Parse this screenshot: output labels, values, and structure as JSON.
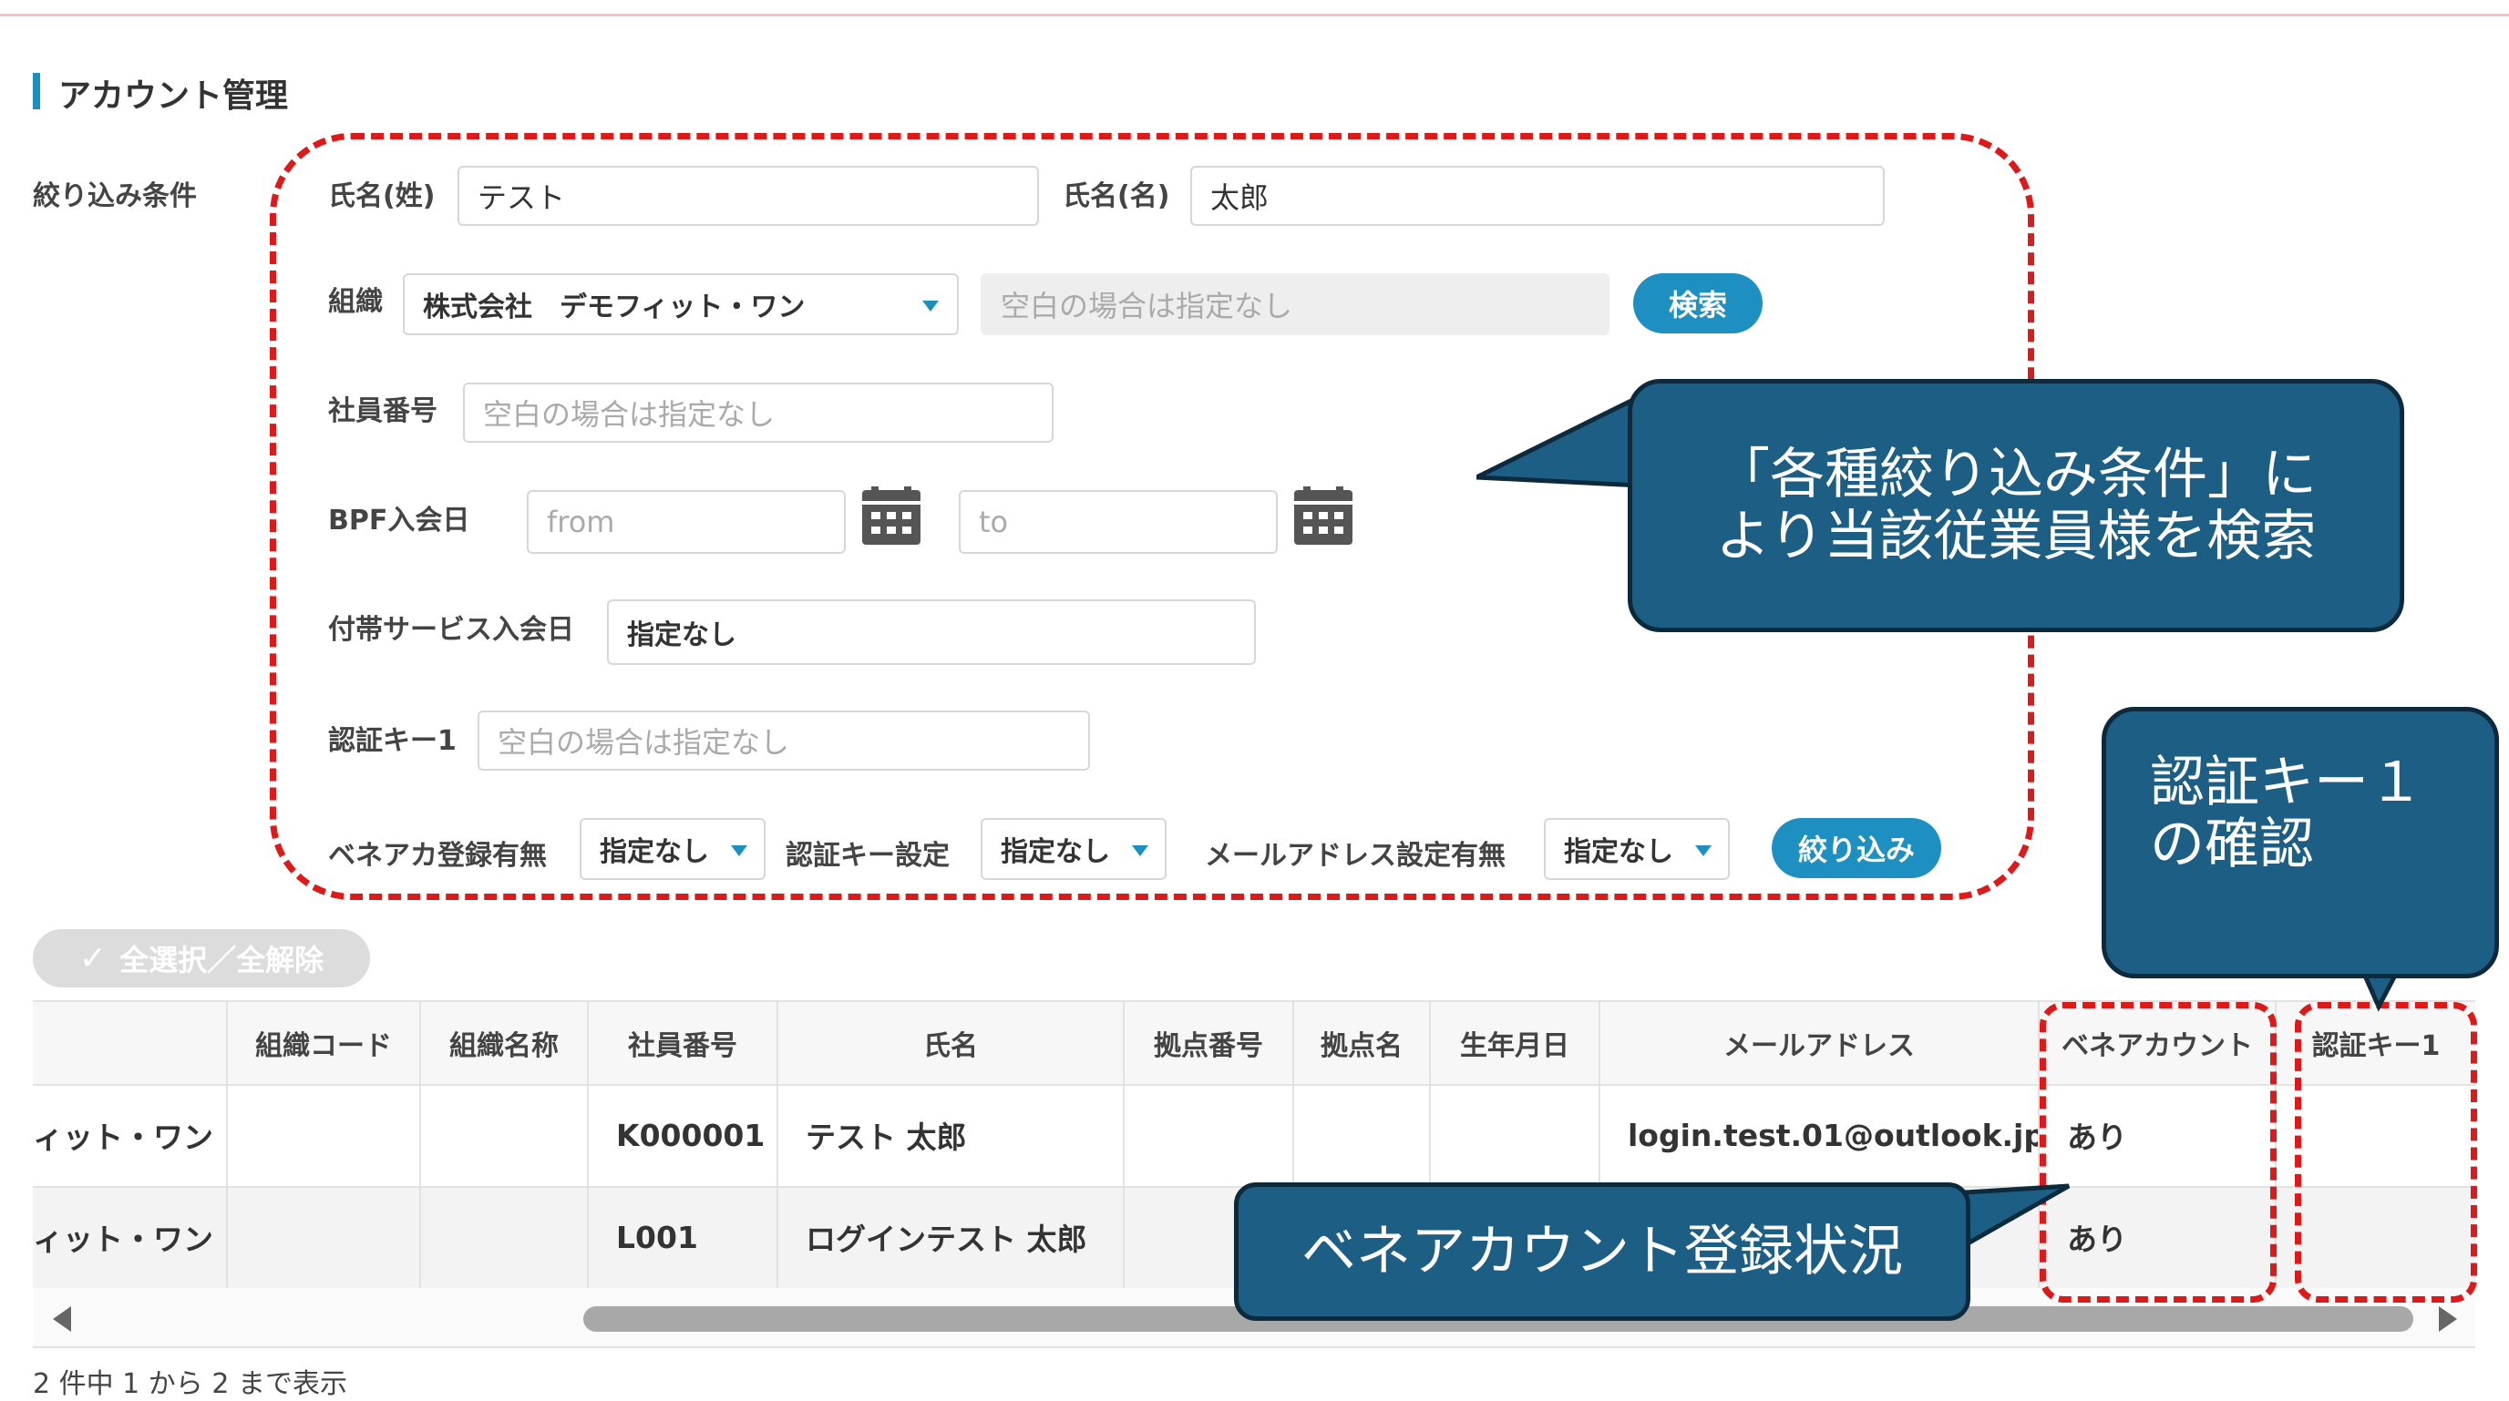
{
  "page": {
    "title": "アカウント管理"
  },
  "filters": {
    "section_label": "絞り込み条件",
    "last_name_label": "氏名(姓)",
    "last_name_value": "テスト",
    "first_name_label": "氏名(名)",
    "first_name_value": "太郎",
    "org_label": "組織",
    "org_value": "株式会社　デモフィット・ワン",
    "org_search_placeholder": "空白の場合は指定なし",
    "search_button": "検索",
    "employee_no_label": "社員番号",
    "employee_no_placeholder": "空白の場合は指定なし",
    "bpf_join_label": "BPF入会日",
    "bpf_from_placeholder": "from",
    "bpf_to_placeholder": "to",
    "service_join_label": "付帯サービス入会日",
    "service_join_value": "指定なし",
    "auth_key_label": "認証キー1",
    "auth_key_placeholder": "空白の場合は指定なし",
    "bene_reg_label": "ベネアカ登録有無",
    "bene_reg_value": "指定なし",
    "auth_key_setting_label": "認証キー設定",
    "auth_key_setting_value": "指定なし",
    "mail_setting_label": "メールアドレス設定有無",
    "mail_setting_value": "指定なし",
    "filter_button": "絞り込み"
  },
  "select_all_button": "全選択／全解除",
  "table": {
    "headers": [
      "組織コード",
      "組織名称",
      "社員番号",
      "氏名",
      "拠点番号",
      "拠点名",
      "生年月日",
      "メールアドレス",
      "ベネアカウント",
      "認証キー1"
    ],
    "rows": [
      {
        "org_tail": "ィット・ワン",
        "org_code": "",
        "org_name": "",
        "employee_no": "K000001",
        "name": "テスト 太郎",
        "site_no": "",
        "site_name": "",
        "birth": "",
        "email": "login.test.01@outlook.jp",
        "bene": "あり",
        "auth_key": ""
      },
      {
        "org_tail": "ィット・ワン",
        "org_code": "",
        "org_name": "",
        "employee_no": "L001",
        "name": "ログインテスト 太郎",
        "site_no": "",
        "site_name": "",
        "birth": "",
        "email": "",
        "bene": "あり",
        "auth_key": ""
      }
    ]
  },
  "pagination_text": "2 件中 1 から 2 まで表示",
  "callouts": {
    "search": [
      "「各種絞り込み条件」に",
      "より当該従業員様を検索"
    ],
    "auth": [
      "認証キー１",
      "の確認"
    ],
    "bene": "ベネアカウント登録状況"
  },
  "colors": {
    "accent": "#1d8fc0",
    "callout": "#1d5f84",
    "highlight": "#dd1a1a"
  }
}
